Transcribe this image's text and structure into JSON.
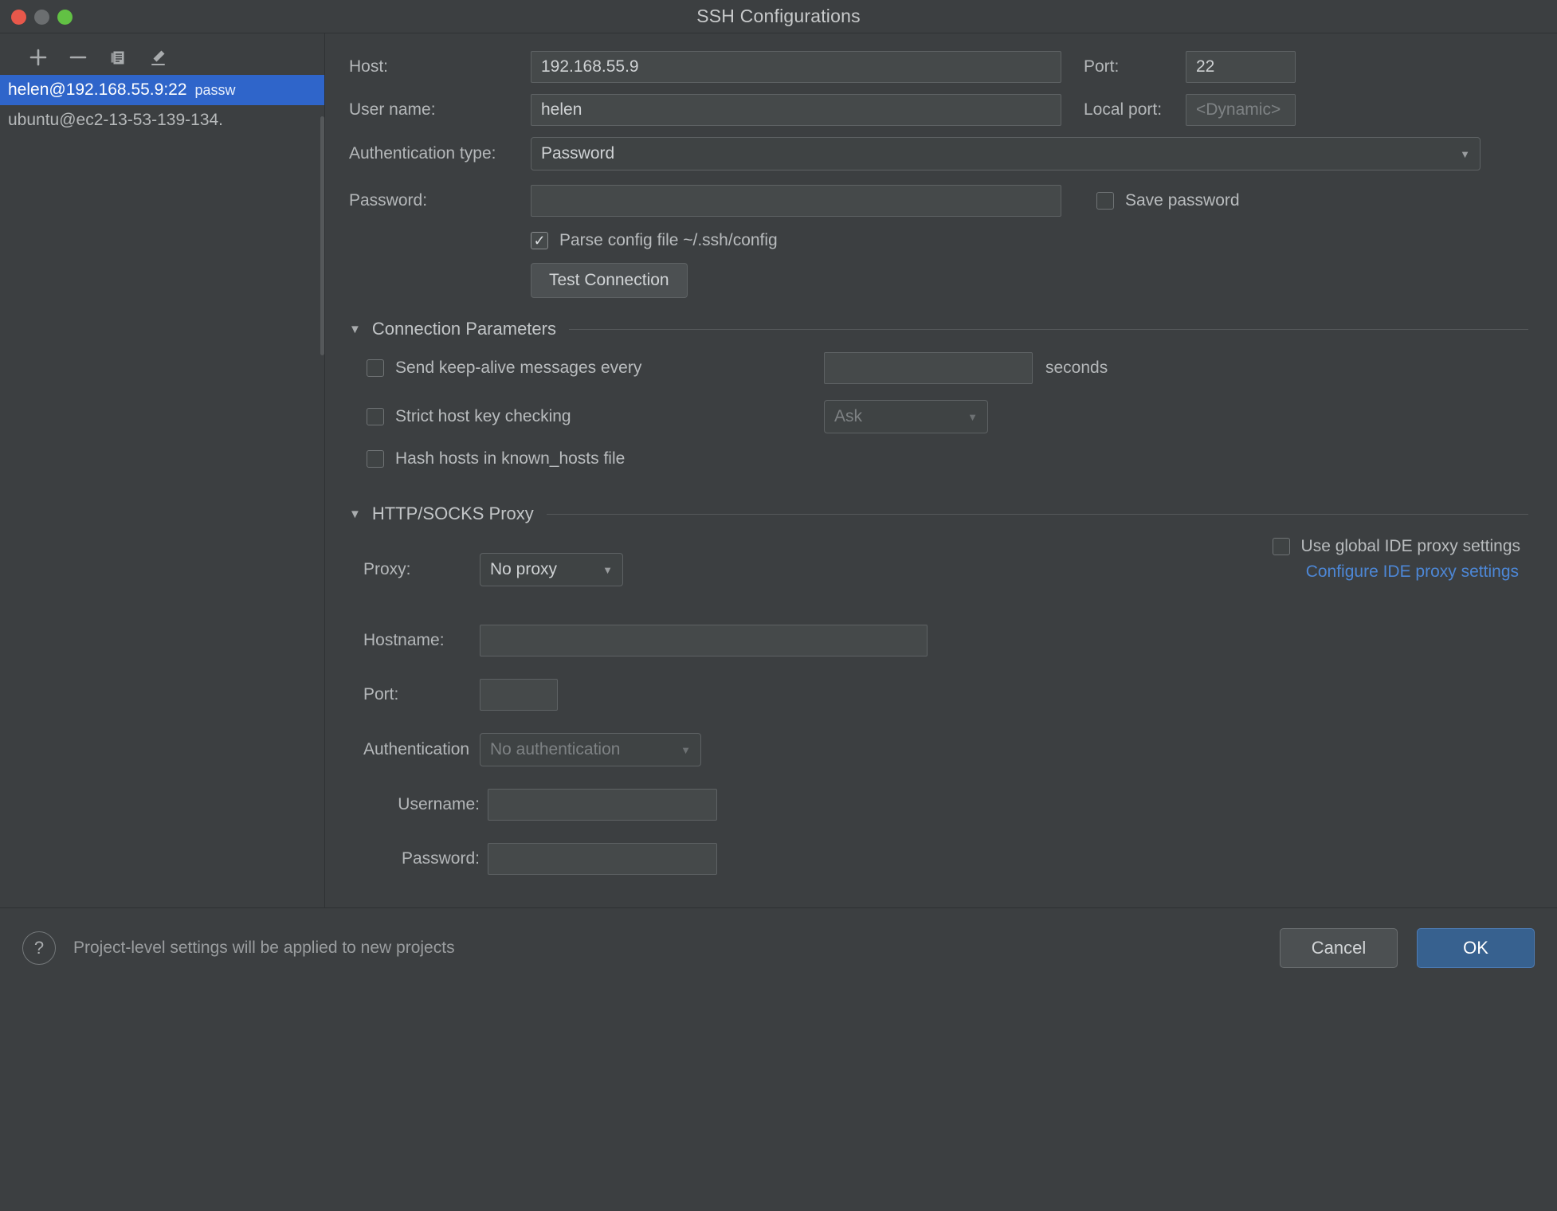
{
  "window": {
    "title": "SSH Configurations",
    "traffic_lights": [
      "close",
      "minimize",
      "zoom"
    ]
  },
  "sidebar": {
    "toolbar": [
      {
        "name": "add",
        "glyph": "+"
      },
      {
        "name": "remove",
        "glyph": "−"
      },
      {
        "name": "copy",
        "glyph": "copy"
      },
      {
        "name": "edit",
        "glyph": "pencil"
      }
    ],
    "items": [
      {
        "label": "helen@192.168.55.9:22",
        "suffix": "passw",
        "selected": true
      },
      {
        "label": "ubuntu@ec2-13-53-139-134.",
        "suffix": "",
        "selected": false
      }
    ]
  },
  "form": {
    "host_label": "Host:",
    "host_value": "192.168.55.9",
    "port_label": "Port:",
    "port_value": "22",
    "username_label": "User name:",
    "username_value": "helen",
    "local_port_label": "Local port:",
    "local_port_placeholder": "<Dynamic>",
    "auth_type_label": "Authentication type:",
    "auth_type_value": "Password",
    "password_label": "Password:",
    "password_value": "",
    "save_password_label": "Save password",
    "save_password_checked": false,
    "parse_config_label": "Parse config file ~/.ssh/config",
    "parse_config_checked": true,
    "test_connection_label": "Test Connection"
  },
  "connection_parameters": {
    "section_title": "Connection Parameters",
    "keep_alive_label": "Send keep-alive messages every",
    "keep_alive_checked": false,
    "keep_alive_value": "",
    "seconds_label": "seconds",
    "strict_host_label": "Strict host key checking",
    "strict_host_checked": false,
    "strict_host_value": "Ask",
    "hash_hosts_label": "Hash hosts in known_hosts file",
    "hash_hosts_checked": false
  },
  "proxy": {
    "section_title": "HTTP/SOCKS Proxy",
    "use_global_label": "Use global IDE proxy settings",
    "use_global_checked": false,
    "configure_link": "Configure IDE proxy settings",
    "proxy_label": "Proxy:",
    "proxy_value": "No proxy",
    "hostname_label": "Hostname:",
    "hostname_value": "",
    "port_label": "Port:",
    "port_value": "",
    "authentication_label": "Authentication",
    "authentication_value": "No authentication",
    "username_label": "Username:",
    "username_value": "",
    "password_label": "Password:",
    "password_value": ""
  },
  "footer": {
    "help_glyph": "?",
    "status_text": "Project-level settings will be applied to new projects",
    "cancel_label": "Cancel",
    "ok_label": "OK"
  },
  "colors": {
    "background": "#3c3f41",
    "selection": "#2f65ca",
    "link": "#4d87d6",
    "ok_button": "#37618f"
  }
}
